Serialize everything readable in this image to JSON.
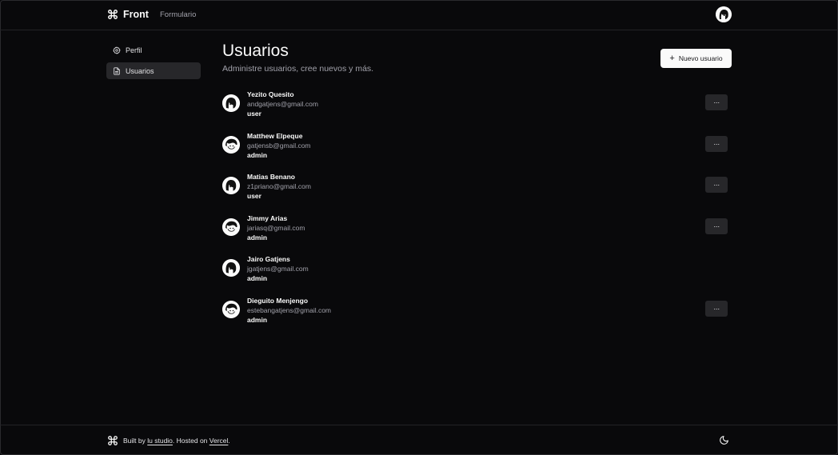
{
  "header": {
    "brand": "Front",
    "brand_icon": "command-icon",
    "nav_link": "Formulario"
  },
  "sidebar": {
    "items": [
      {
        "label": "Perfil",
        "icon": "gear-icon",
        "active": false
      },
      {
        "label": "Usuarios",
        "icon": "file-icon",
        "active": true
      }
    ]
  },
  "main": {
    "title": "Usuarios",
    "subtitle": "Administre usuarios, cree nuevos y más.",
    "new_button": "Nuevo usuario",
    "more_label": "···"
  },
  "users": [
    {
      "name": "Yezito Quesito",
      "email": "andgatjens@gmail.com",
      "role": "user",
      "has_menu": true
    },
    {
      "name": "Matthew Elpeque",
      "email": "gatjensb@gmail.com",
      "role": "admin",
      "has_menu": true
    },
    {
      "name": "Matias Benano",
      "email": "z1priano@gmail.com",
      "role": "user",
      "has_menu": true
    },
    {
      "name": "Jimmy Arias",
      "email": "jariasq@gmail.com",
      "role": "admin",
      "has_menu": true
    },
    {
      "name": "Jairo Gatjens",
      "email": "jgatjens@gmail.com",
      "role": "admin",
      "has_menu": false
    },
    {
      "name": "Dieguito Menjengo",
      "email": "estebangatjens@gmail.com",
      "role": "admin",
      "has_menu": true
    }
  ],
  "footer": {
    "prefix": "Built by ",
    "studio": "lu studio",
    "mid": ". Hosted on ",
    "host": "Vercel",
    "suffix": "."
  },
  "colors": {
    "background": "#09090b",
    "muted": "#a1a1aa",
    "button_bg": "#fafafa",
    "menu_bg": "#27272a"
  }
}
